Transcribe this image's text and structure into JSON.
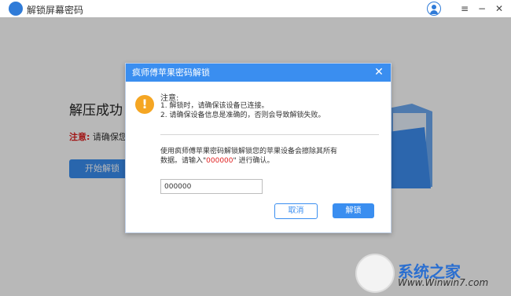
{
  "app": {
    "title": "解锁屏幕密码"
  },
  "window_controls": {
    "menu": "≡",
    "minimize": "−",
    "close": "✕"
  },
  "background_page": {
    "title": "解压成功",
    "note_label": "注意:",
    "note_text": "请确保您的",
    "start_button": "开始解锁"
  },
  "dialog": {
    "header": "疯师傅苹果密码解锁",
    "close": "✕",
    "warning_icon": "!",
    "note_title": "注意:",
    "note_line1": "1. 解锁时，请确保该设备已连接。",
    "note_line2": "2. 请确保设备信息是准确的，否则会导致解锁失败。",
    "desc_line1": "使用疯师傅苹果密码解锁解锁您的苹果设备会擦除其所有",
    "desc_line2_prefix": "数据。请输入\"",
    "desc_line2_code": "000000",
    "desc_line2_suffix": "\" 进行确认。",
    "input_value": "000000",
    "cancel_button": "取消",
    "unlock_button": "解锁"
  },
  "watermark": {
    "brand": "系统之家",
    "url": "Www.Winwin7.com"
  },
  "colors": {
    "accent": "#3a8ef0",
    "warning": "#f5a623",
    "highlight": "#e02020"
  }
}
